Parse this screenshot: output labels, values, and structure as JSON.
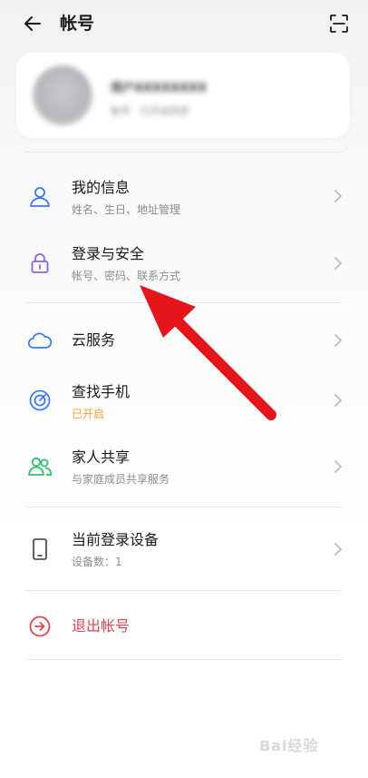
{
  "header": {
    "title": "帐号"
  },
  "profile": {
    "name_blurred": "用户XXXXXXXX",
    "subtitle_blurred": "帐号 · 已开启同步"
  },
  "menu": {
    "my_info": {
      "title": "我的信息",
      "subtitle": "姓名、生日、地址管理"
    },
    "login_security": {
      "title": "登录与安全",
      "subtitle": "帐号、密码、联系方式"
    },
    "cloud": {
      "title": "云服务"
    },
    "find_phone": {
      "title": "查找手机",
      "subtitle": "已开启"
    },
    "family_share": {
      "title": "家人共享",
      "subtitle": "与家庭成员共享服务"
    },
    "current_device": {
      "title": "当前登录设备",
      "subtitle": "设备数：1"
    },
    "logout": {
      "title": "退出帐号"
    }
  },
  "colors": {
    "accent_blue": "#3b7bf0",
    "accent_purple": "#8a63e0",
    "accent_green": "#2fbf6a",
    "logout_red": "#e5424f",
    "status_orange": "#f0a12b",
    "annotation_red": "#e5161b"
  },
  "icons": {
    "back": "back-arrow-icon",
    "scan": "scan-icon",
    "my_info": "person-icon",
    "login_security": "lock-icon",
    "cloud": "cloud-icon",
    "find_phone": "target-icon",
    "family_share": "people-icon",
    "current_device": "phone-icon",
    "logout": "exit-arrow-icon",
    "chevron": "chevron-right-icon"
  },
  "watermark": "Bai经验"
}
